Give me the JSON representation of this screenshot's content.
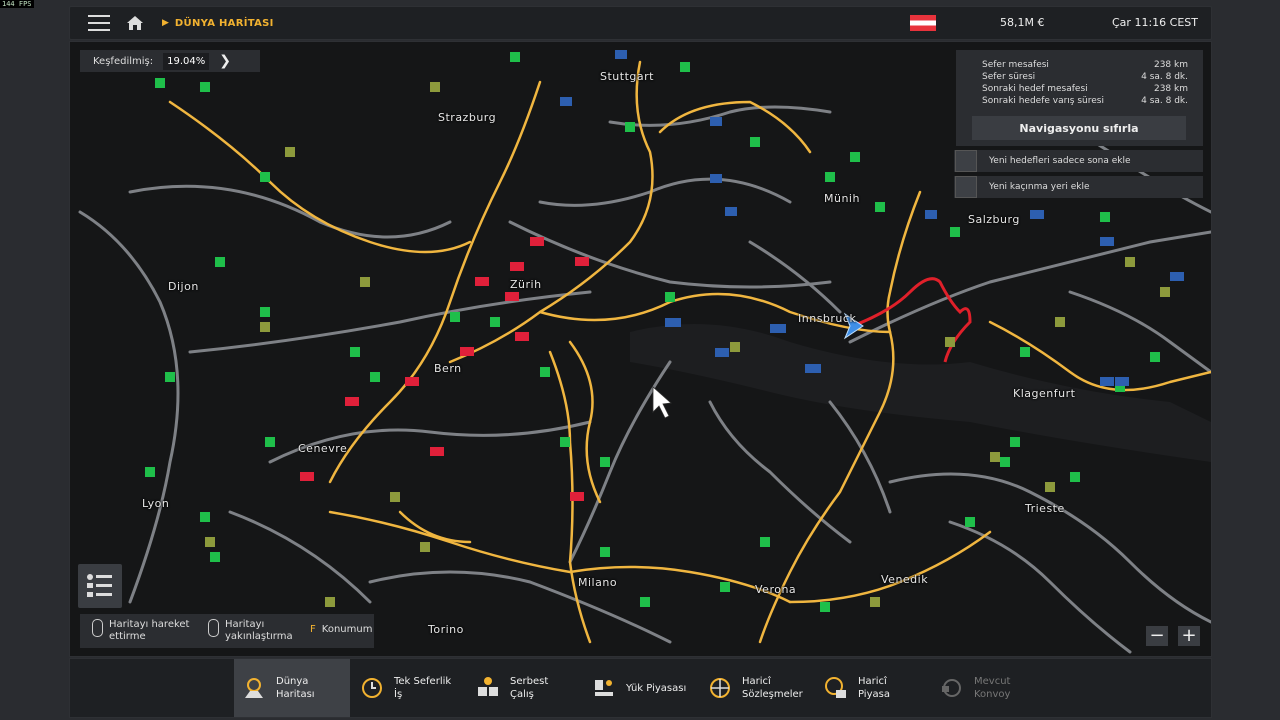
{
  "fps": "144 FPS",
  "topbar": {
    "breadcrumb": "DÜNYA HARİTASI",
    "money": "58,1M  €",
    "time": "Çar 11:16 CEST"
  },
  "explored": {
    "label": "Keşfedilmiş:",
    "value": "19.04%"
  },
  "route_info": {
    "rows": [
      {
        "label": "Sefer mesafesi",
        "value": "238 km"
      },
      {
        "label": "Sefer süresi",
        "value": "4 sa. 8 dk."
      },
      {
        "label": "Sonraki hedef mesafesi",
        "value": "238 km"
      },
      {
        "label": "Sonraki hedefe varış süresi",
        "value": "4 sa. 8 dk."
      }
    ],
    "reset_label": "Navigasyonu sıfırla",
    "option1": "Yeni hedefleri sadece sona ekle",
    "option2": "Yeni kaçınma yeri ekle"
  },
  "cities": [
    "Stuttgart",
    "Strazburg",
    "Münih",
    "Salzburg",
    "Dijon",
    "Zürih",
    "Bern",
    "Innsbruck",
    "Cenevre",
    "Klagenfurt",
    "Lyon",
    "Trieste",
    "Milano",
    "Verona",
    "Venedik",
    "Torino"
  ],
  "hints": {
    "move": "Haritayı hareket ettirme",
    "zoom": "Haritayı yakınlaştırma",
    "position_key": "F",
    "position": "Konumum"
  },
  "zoom": {
    "minus": "−",
    "plus": "+"
  },
  "tabs": [
    {
      "label": "Dünya Haritası"
    },
    {
      "label": "Tek Seferlik İş"
    },
    {
      "label": "Serbest Çalış"
    },
    {
      "label": "Yük Piyasası"
    },
    {
      "label": "Haricî Sözleşmeler"
    },
    {
      "label": "Haricî Piyasa"
    },
    {
      "label": "Mevcut Konvoy"
    }
  ],
  "colors": {
    "accent": "#f2b230",
    "route": "#e0202a",
    "road_major": "#f5b83c",
    "road_minor": "#8a8d92",
    "service_green": "#1fbf4a",
    "player": "#3f8fe8"
  }
}
